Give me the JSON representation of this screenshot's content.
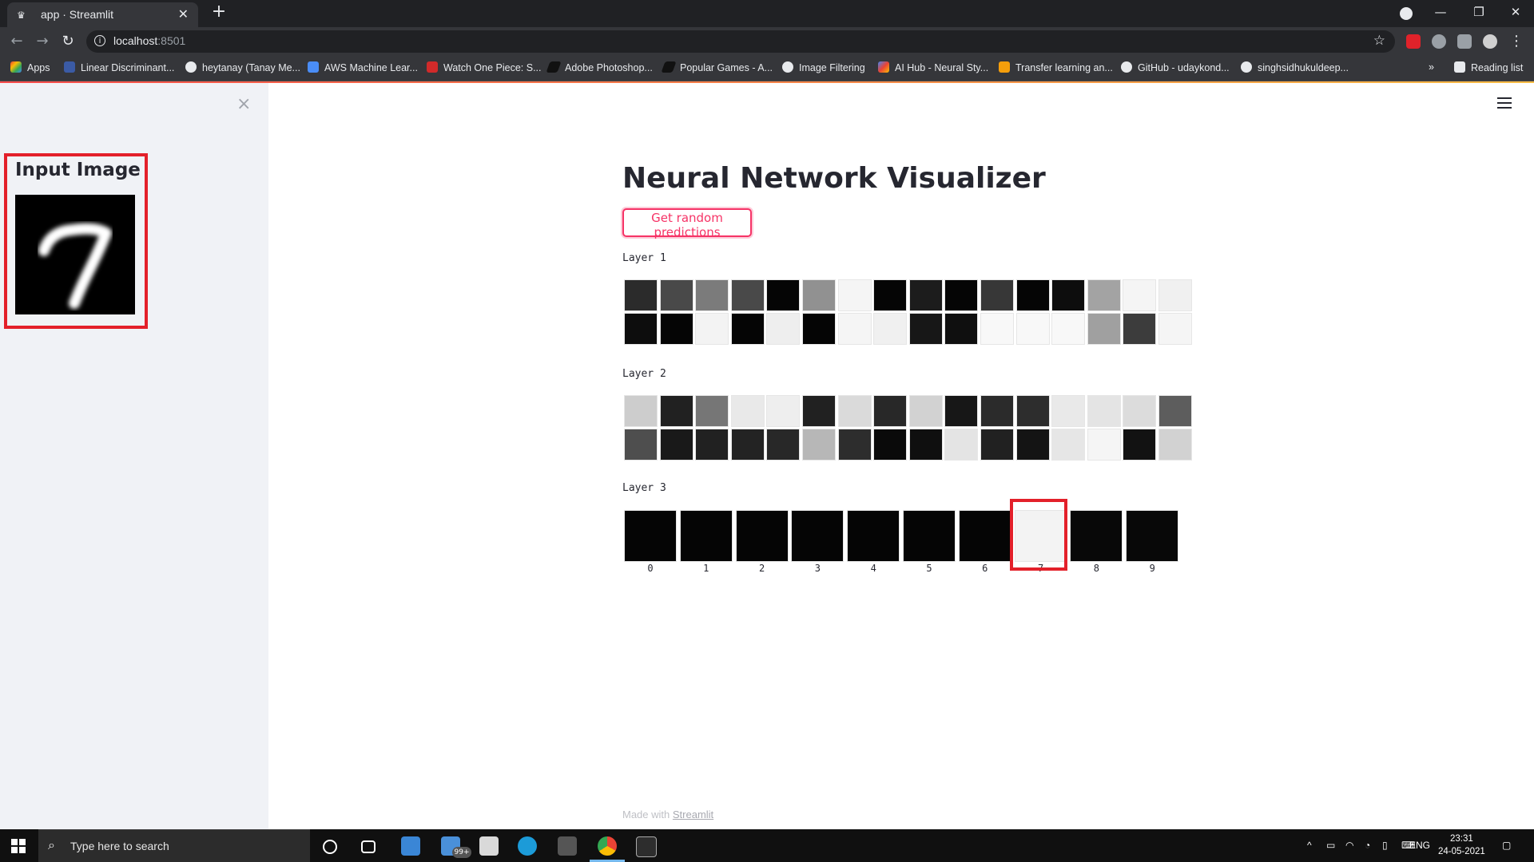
{
  "browser": {
    "tab_title": "app · Streamlit",
    "url_host": "localhost",
    "url_port": ":8501",
    "bookmarks": [
      "Apps",
      "Linear Discriminant...",
      "heytanay (Tanay Me...",
      "AWS Machine Lear...",
      "Watch One Piece: S...",
      "Adobe Photoshop...",
      "Popular Games - A...",
      "Image Filtering",
      "AI Hub - Neural Sty...",
      "Transfer learning an...",
      "GitHub - udaykond...",
      "singhsidhukuldeep..."
    ],
    "overflow": "»",
    "reading_list": "Reading list"
  },
  "sidebar": {
    "close_glyph": "×",
    "input_title": "Input Image"
  },
  "main": {
    "title": "Neural Network Visualizer",
    "button_label": "Get random predictions",
    "layer1_label": "Layer 1",
    "layer2_label": "Layer 2",
    "layer3_label": "Layer 3",
    "footer_prefix": "Made with",
    "footer_link": "Streamlit"
  },
  "layers": {
    "layer1": [
      [
        0.17,
        0.29,
        0.49,
        0.29,
        0.02,
        0.58,
        0.98,
        0.02,
        0.11,
        0.02,
        0.22,
        0.02,
        0.05,
        0.65,
        0.98,
        0.96
      ],
      [
        0.05,
        0.02,
        0.97,
        0.02,
        0.95,
        0.02,
        0.98,
        0.96,
        0.09,
        0.06,
        0.99,
        0.99,
        0.99,
        0.64,
        0.24,
        0.98
      ]
    ],
    "layer2": [
      [
        0.82,
        0.13,
        0.47,
        0.93,
        0.95,
        0.13,
        0.87,
        0.16,
        0.84,
        0.09,
        0.17,
        0.18,
        0.93,
        0.91,
        0.88,
        0.37
      ],
      [
        0.31,
        0.1,
        0.13,
        0.14,
        0.16,
        0.73,
        0.18,
        0.04,
        0.06,
        0.91,
        0.13,
        0.08,
        0.92,
        0.98,
        0.07,
        0.84
      ]
    ],
    "layer3": {
      "labels": [
        "0",
        "1",
        "2",
        "3",
        "4",
        "5",
        "6",
        "7",
        "8",
        "9"
      ],
      "values": [
        0.02,
        0.02,
        0.02,
        0.02,
        0.02,
        0.02,
        0.02,
        0.97,
        0.03,
        0.03
      ]
    }
  },
  "taskbar": {
    "search_placeholder": "Type here to search",
    "badge": "99+",
    "lang": "ENG",
    "time": "23:31",
    "date": "24-05-2021"
  }
}
